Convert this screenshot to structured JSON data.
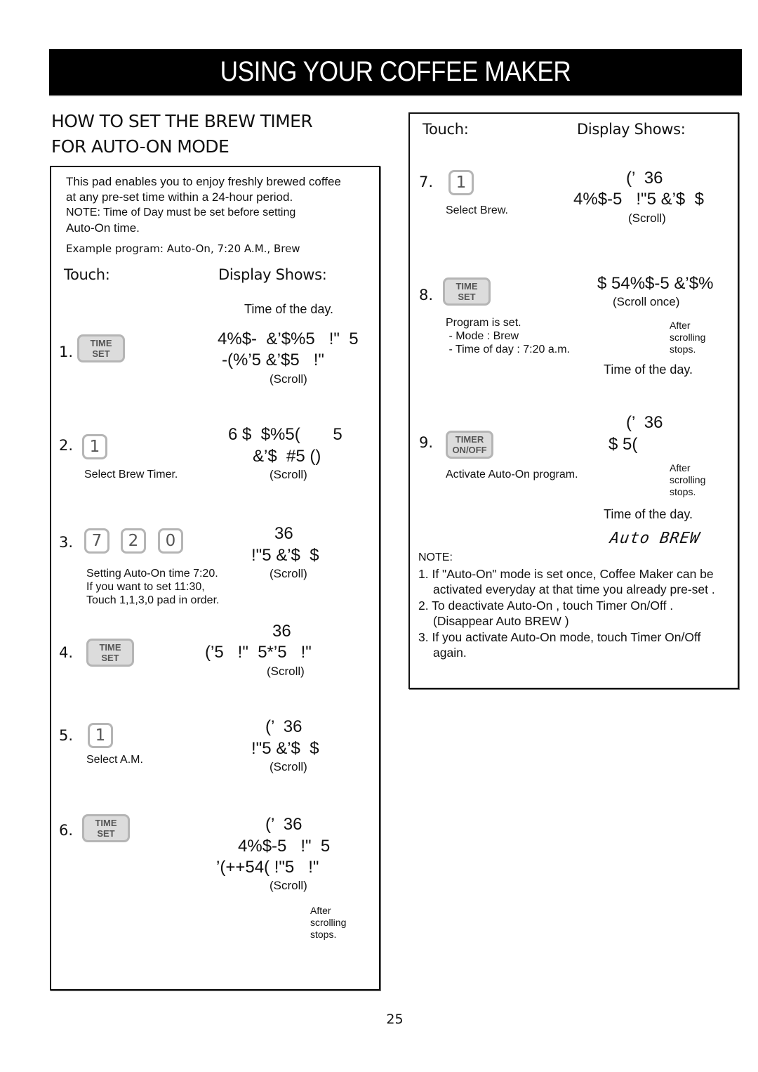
{
  "header": {
    "title": "USING YOUR COFFEE MAKER"
  },
  "section": {
    "title_line1": "HOW TO SET THE BREW TIMER",
    "title_line2": "FOR AUTO-ON MODE"
  },
  "intro": {
    "line1": "This pad enables you to enjoy freshly brewed coffee",
    "line2": "at any pre-set time within a 24-hour period.",
    "note_line1": "NOTE:   Time of Day must be set before setting",
    "note_line2": "Auto-On time.",
    "example": "Example program: Auto-On, 7:20 A.M., Brew"
  },
  "columns": {
    "touch": "Touch:",
    "display": "Display Shows:"
  },
  "steps": [
    {
      "num": "1.",
      "pad": {
        "line1": "TIME",
        "line2": "SET"
      },
      "pre_display": "Time of the day.",
      "display": [
        "4%$-  &’$%5   !\"  5",
        "-(%’5 &’$5   !\""
      ],
      "scroll": "(Scroll)"
    },
    {
      "num": "2.",
      "pad": {
        "label": "1"
      },
      "caption": "Select Brew Timer.",
      "display": [
        "6 $  $%5(       5",
        "&’$  #5 ()"
      ],
      "scroll": "(Scroll)"
    },
    {
      "num": "3.",
      "pads": [
        "7",
        "2",
        "0"
      ],
      "caption": "Setting Auto-On time 7:20.\nIf you want to set 11:30,\nTouch 1,1,3,0 pad in order.",
      "display": [
        "36",
        "!\"5 &’$  $"
      ],
      "scroll": "(Scroll)"
    },
    {
      "num": "4.",
      "pad": {
        "line1": "TIME",
        "line2": "SET"
      },
      "display": [
        "36",
        "(’5   !\"  5*’5   !\""
      ],
      "scroll": "(Scroll)"
    },
    {
      "num": "5.",
      "pad": {
        "label": "1"
      },
      "caption": "Select A.M.",
      "display": [
        "(’  36",
        "!\"5 &’$  $"
      ],
      "scroll": "(Scroll)"
    },
    {
      "num": "6.",
      "pad": {
        "line1": "TIME",
        "line2": "SET"
      },
      "display": [
        "(’  36",
        "4%$-5   !\"  5",
        "’(++54( !\"5   !\""
      ],
      "scroll": "(Scroll)",
      "after": "After\nscrolling\nstops."
    },
    {
      "num": "7.",
      "pad": {
        "label": "1"
      },
      "caption": "Select Brew.",
      "display": [
        "(’  36",
        "4%$-5   !\"5 &’$  $"
      ],
      "scroll": "(Scroll)"
    },
    {
      "num": "8.",
      "pad": {
        "line1": "TIME",
        "line2": "SET"
      },
      "caption": "Program is set.\n - Mode : Brew\n - Time of day : 7:20 a.m.",
      "display": [
        "$ 54%$-5 &’$%"
      ],
      "scroll": "(Scroll once)",
      "after": "After\nscrolling\nstops.",
      "post_display": "Time of the day."
    },
    {
      "num": "9.",
      "pad": {
        "line1": "TIMER",
        "line2": "ON/OFF"
      },
      "caption": "Activate Auto-On program.",
      "display": [
        "(’  36",
        "$ 5("
      ],
      "after": "After\nscrolling\nstops.",
      "post_display": "Time of the day.",
      "lcd": "Auto BREW"
    }
  ],
  "notes": {
    "heading": "NOTE:",
    "items": [
      "1. If \"Auto-On\" mode is set once, Coffee Maker can be activated everyday at that time you already pre-set .",
      "2. To deactivate  Auto-On , touch  Timer On/Off . (Disappear  Auto BREW )",
      "3. If you activate  Auto-On  mode, touch  Timer On/Off  again."
    ]
  },
  "page": {
    "number": "25"
  }
}
